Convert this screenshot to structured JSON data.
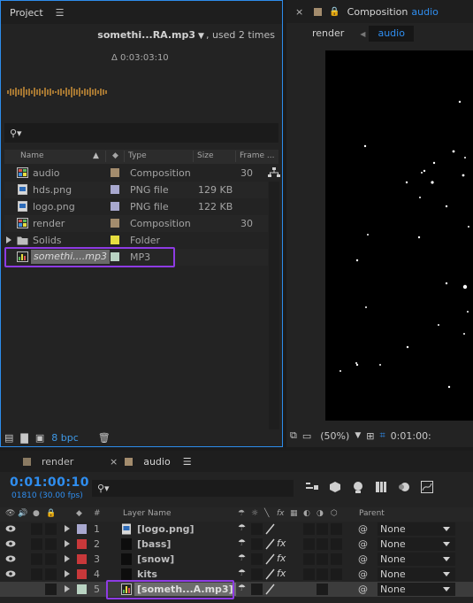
{
  "project": {
    "tab_label": "Project",
    "preview": {
      "name": "somethi...RA.mp3",
      "usage": ", used 2 times",
      "duration": "Δ 0:03:03:10"
    },
    "columns": {
      "name": "Name",
      "type": "Type",
      "size": "Size",
      "frame": "Frame ..."
    },
    "items": [
      {
        "name": "audio",
        "type": "Composition",
        "size": "",
        "frame": "30",
        "label_color": "#a38c6d",
        "icon": "composition-icon"
      },
      {
        "name": "hds.png",
        "type": "PNG file",
        "size": "129 KB",
        "frame": "",
        "label_color": "#a8a8cf",
        "icon": "image-file-icon"
      },
      {
        "name": "logo.png",
        "type": "PNG file",
        "size": "122 KB",
        "frame": "",
        "label_color": "#a8a8cf",
        "icon": "image-file-icon"
      },
      {
        "name": "render",
        "type": "Composition",
        "size": "",
        "frame": "30",
        "label_color": "#a38c6d",
        "icon": "composition-icon"
      },
      {
        "name": "Solids",
        "type": "Folder",
        "size": "",
        "frame": "",
        "label_color": "#e6dd3f",
        "icon": "folder-icon"
      },
      {
        "name": "somethi....mp3",
        "type": "MP3",
        "size": "",
        "frame": "",
        "label_color": "#b9d3c2",
        "icon": "audio-file-icon"
      }
    ],
    "bpc": "8 bpc"
  },
  "composition": {
    "tab_prefix": "Composition",
    "tab_name": "audio",
    "sub_tabs": [
      "render",
      "audio"
    ],
    "zoom": "(50%)",
    "time": "0:01:00:"
  },
  "timeline": {
    "tabs": [
      {
        "label": "render"
      },
      {
        "label": "audio"
      }
    ],
    "timecode": "0:01:00:10",
    "frame_info": "01810 (30.00 fps)",
    "headers": {
      "num": "#",
      "layer_name": "Layer Name",
      "parent": "Parent"
    },
    "layers": [
      {
        "num": "1",
        "name": "[logo.png]",
        "label_color": "#a8a8cf",
        "fx": false,
        "parent": "None"
      },
      {
        "num": "2",
        "name": "[bass]",
        "label_color": "#c8383a",
        "fx": true,
        "parent": "None"
      },
      {
        "num": "3",
        "name": "[snow]",
        "label_color": "#c8383a",
        "fx": true,
        "parent": "None"
      },
      {
        "num": "4",
        "name": "kits",
        "label_color": "#c8383a",
        "fx": true,
        "parent": "None"
      },
      {
        "num": "5",
        "name": "[someth...A.mp3]",
        "label_color": "#b9d3c2",
        "fx": false,
        "parent": "None"
      }
    ]
  },
  "colors": {
    "accent": "#2f8ef0",
    "highlight": "#8e3be3"
  }
}
